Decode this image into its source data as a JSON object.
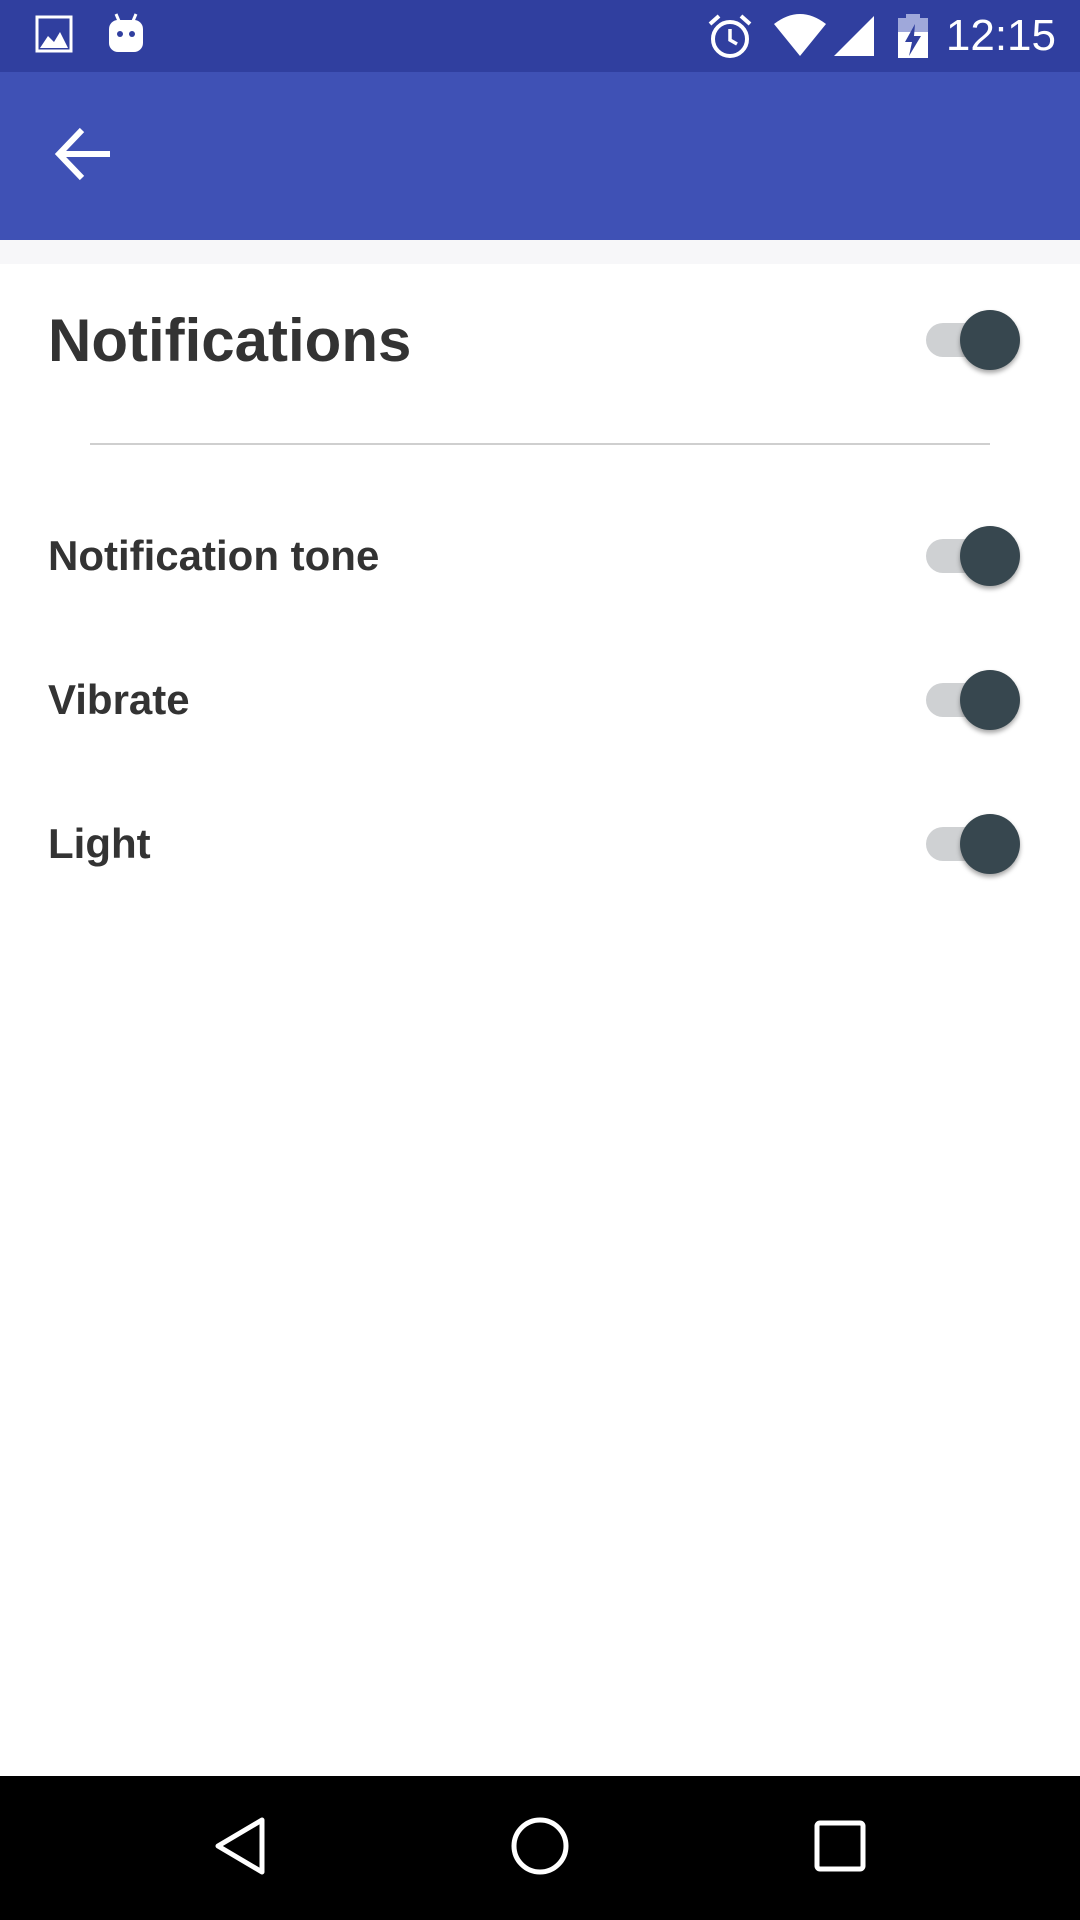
{
  "status_bar": {
    "time": "12:15",
    "icons": [
      "image-icon",
      "android-icon",
      "alarm-icon",
      "wifi-icon",
      "signal-icon",
      "battery-charging-icon"
    ],
    "background": "#303f9f"
  },
  "app_bar": {
    "back_icon": "arrow-back-icon",
    "background": "#3f51b5"
  },
  "settings": {
    "header": {
      "label": "Notifications",
      "enabled": true
    },
    "items": [
      {
        "label": "Notification tone",
        "enabled": true
      },
      {
        "label": "Vibrate",
        "enabled": true
      },
      {
        "label": "Light",
        "enabled": true
      }
    ]
  },
  "nav_bar": {
    "icons": [
      "nav-back-icon",
      "nav-home-icon",
      "nav-recents-icon"
    ]
  },
  "colors": {
    "switch_thumb": "#37474f",
    "switch_track": "#cfd1d3",
    "text": "#333333"
  }
}
